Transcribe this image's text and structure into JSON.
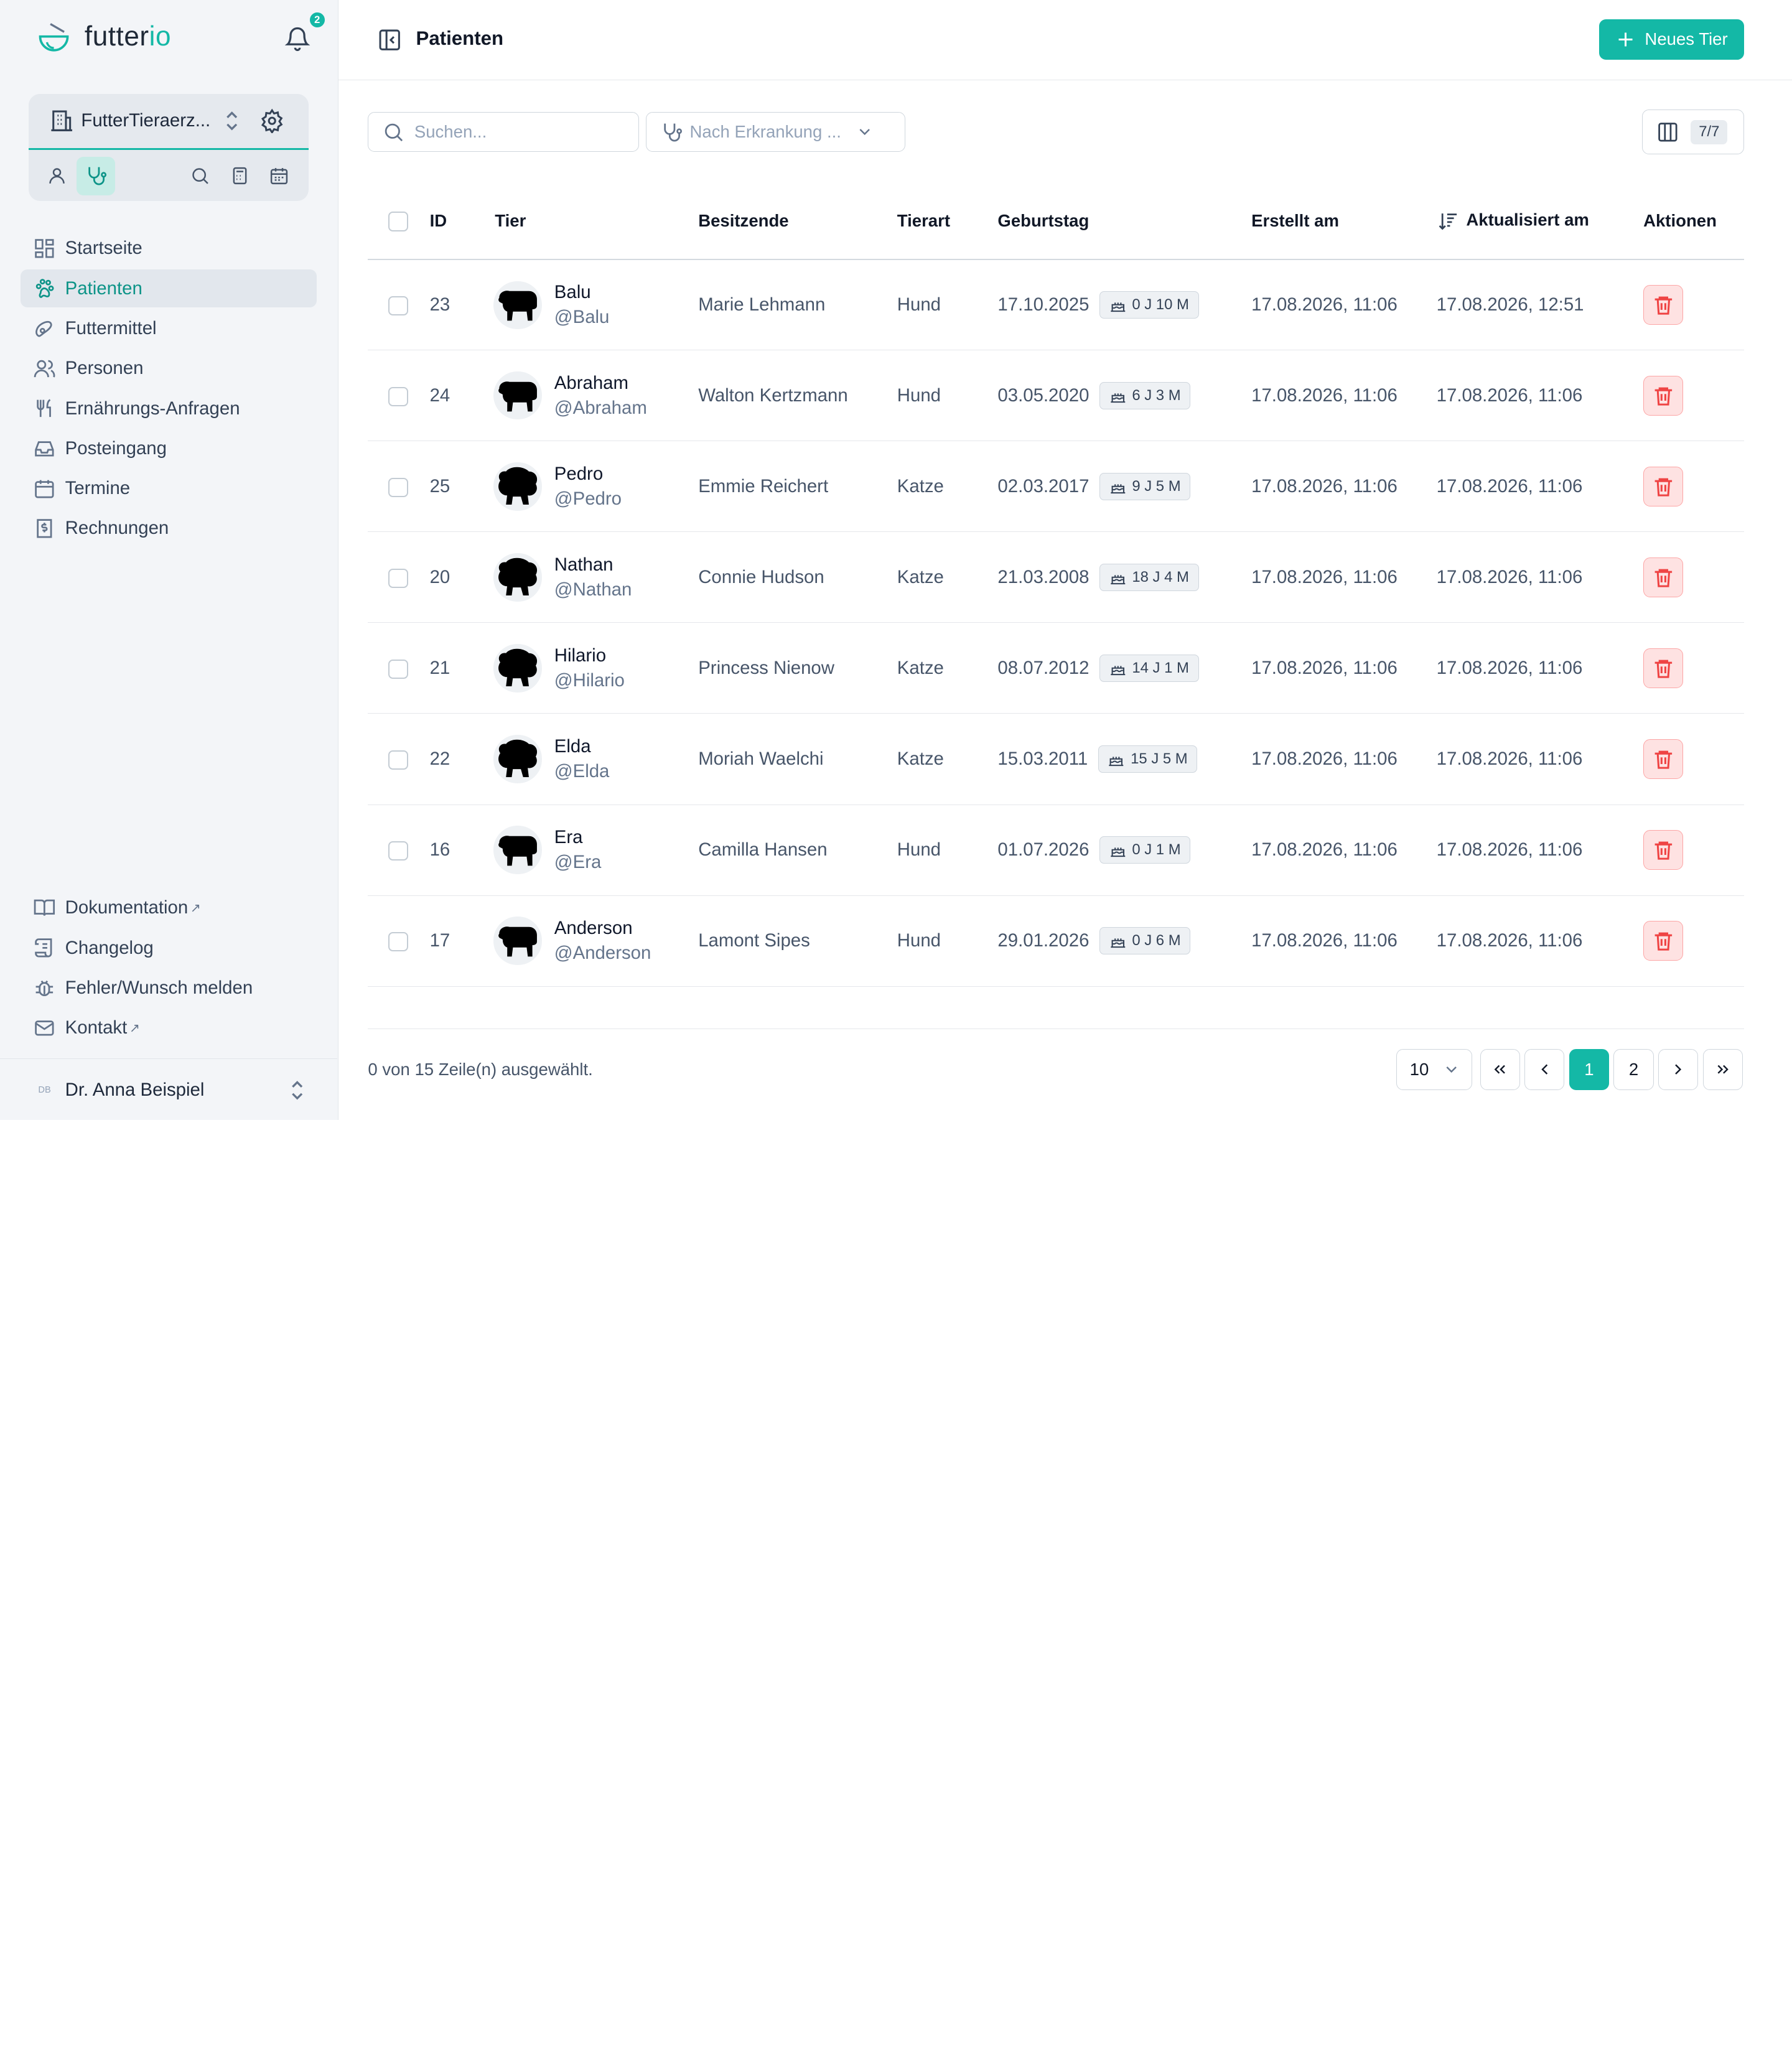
{
  "brand": {
    "name_main": "futter",
    "name_accent": "io"
  },
  "notifications": {
    "count": "2"
  },
  "clinic": {
    "name": "FutterTieraerz..."
  },
  "nav": {
    "items": [
      {
        "label": "Startseite",
        "icon": "grid-icon"
      },
      {
        "label": "Patienten",
        "icon": "paw-icon",
        "active": true
      },
      {
        "label": "Futtermittel",
        "icon": "food-icon"
      },
      {
        "label": "Personen",
        "icon": "users-icon"
      },
      {
        "label": "Ernährungs-Anfragen",
        "icon": "utensils-icon"
      },
      {
        "label": "Posteingang",
        "icon": "inbox-icon"
      },
      {
        "label": "Termine",
        "icon": "calendar-icon"
      },
      {
        "label": "Rechnungen",
        "icon": "receipt-icon"
      }
    ],
    "bottom": [
      {
        "label": "Dokumentation",
        "external": true
      },
      {
        "label": "Changelog"
      },
      {
        "label": "Fehler/Wunsch melden"
      },
      {
        "label": "Kontakt",
        "external": true
      }
    ]
  },
  "user": {
    "initials": "DB",
    "name": "Dr. Anna Beispiel"
  },
  "header": {
    "title": "Patienten",
    "new_button": "Neues Tier"
  },
  "search": {
    "placeholder": "Suchen...",
    "value": ""
  },
  "filter": {
    "label": "Nach Erkrankung ..."
  },
  "columns_toggle": {
    "count": "7/7"
  },
  "table": {
    "headers": {
      "id": "ID",
      "tier": "Tier",
      "besitzende": "Besitzende",
      "tierart": "Tierart",
      "geburtstag": "Geburtstag",
      "erstellt": "Erstellt am",
      "aktualisiert": "Aktualisiert am",
      "aktionen": "Aktionen"
    },
    "rows": [
      {
        "id": "23",
        "name": "Balu",
        "handle": "@Balu",
        "owner": "Marie Lehmann",
        "species": "Hund",
        "birthday": "17.10.2025",
        "age": "0 J 10 M",
        "created": "17.08.2026, 11:06",
        "updated": "17.08.2026, 12:51"
      },
      {
        "id": "24",
        "name": "Abraham",
        "handle": "@Abraham",
        "owner": "Walton Kertzmann",
        "species": "Hund",
        "birthday": "03.05.2020",
        "age": "6 J 3 M",
        "created": "17.08.2026, 11:06",
        "updated": "17.08.2026, 11:06"
      },
      {
        "id": "25",
        "name": "Pedro",
        "handle": "@Pedro",
        "owner": "Emmie Reichert",
        "species": "Katze",
        "birthday": "02.03.2017",
        "age": "9 J 5 M",
        "created": "17.08.2026, 11:06",
        "updated": "17.08.2026, 11:06"
      },
      {
        "id": "20",
        "name": "Nathan",
        "handle": "@Nathan",
        "owner": "Connie Hudson",
        "species": "Katze",
        "birthday": "21.03.2008",
        "age": "18 J 4 M",
        "created": "17.08.2026, 11:06",
        "updated": "17.08.2026, 11:06"
      },
      {
        "id": "21",
        "name": "Hilario",
        "handle": "@Hilario",
        "owner": "Princess Nienow",
        "species": "Katze",
        "birthday": "08.07.2012",
        "age": "14 J 1 M",
        "created": "17.08.2026, 11:06",
        "updated": "17.08.2026, 11:06"
      },
      {
        "id": "22",
        "name": "Elda",
        "handle": "@Elda",
        "owner": "Moriah Waelchi",
        "species": "Katze",
        "birthday": "15.03.2011",
        "age": "15 J 5 M",
        "created": "17.08.2026, 11:06",
        "updated": "17.08.2026, 11:06"
      },
      {
        "id": "16",
        "name": "Era",
        "handle": "@Era",
        "owner": "Camilla Hansen",
        "species": "Hund",
        "birthday": "01.07.2026",
        "age": "0 J 1 M",
        "created": "17.08.2026, 11:06",
        "updated": "17.08.2026, 11:06"
      },
      {
        "id": "17",
        "name": "Anderson",
        "handle": "@Anderson",
        "owner": "Lamont Sipes",
        "species": "Hund",
        "birthday": "29.01.2026",
        "age": "0 J 6 M",
        "created": "17.08.2026, 11:06",
        "updated": "17.08.2026, 11:06"
      }
    ]
  },
  "footer": {
    "selection": "0 von 15 Zeile(n) ausgewählt.",
    "page_size": "10",
    "pages": [
      "1",
      "2"
    ],
    "current_page": "1"
  },
  "colors": {
    "accent": "#14b8a6",
    "danger": "#ef4444"
  }
}
